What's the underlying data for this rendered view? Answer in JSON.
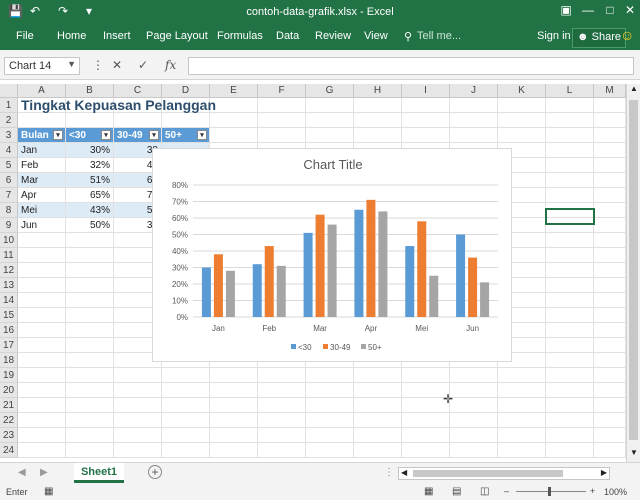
{
  "window": {
    "title": "contoh-data-grafik.xlsx - Excel"
  },
  "ribbon": {
    "tabs": [
      "File",
      "Home",
      "Insert",
      "Page Layout",
      "Formulas",
      "Data",
      "Review",
      "View"
    ],
    "tellme": "Tell me...",
    "signin": "Sign in",
    "share": "Share"
  },
  "formula": {
    "namebox": "Chart 14",
    "value": ""
  },
  "columns": [
    "A",
    "B",
    "C",
    "D",
    "E",
    "F",
    "G",
    "H",
    "I",
    "J",
    "K",
    "L",
    "M"
  ],
  "rows": [
    "1",
    "2",
    "3",
    "4",
    "5",
    "6",
    "7",
    "8",
    "9",
    "10",
    "11",
    "12",
    "13",
    "14",
    "15",
    "16",
    "17",
    "18",
    "19",
    "20",
    "21",
    "22",
    "23",
    "24"
  ],
  "sheet": {
    "title": "Tingkat Kepuasan Pelanggan",
    "headers": [
      "Bulan",
      "<30",
      "30-49",
      "50+"
    ],
    "data": [
      [
        "Jan",
        "30%",
        "38"
      ],
      [
        "Feb",
        "32%",
        "43"
      ],
      [
        "Mar",
        "51%",
        "62"
      ],
      [
        "Apr",
        "65%",
        "71"
      ],
      [
        "Mei",
        "43%",
        "58"
      ],
      [
        "Jun",
        "50%",
        "36"
      ]
    ]
  },
  "chart_data": {
    "type": "bar",
    "title": "Chart Title",
    "categories": [
      "Jan",
      "Feb",
      "Mar",
      "Apr",
      "Mei",
      "Jun"
    ],
    "series": [
      {
        "name": "<30",
        "values": [
          30,
          32,
          51,
          65,
          43,
          50
        ],
        "color": "#5b9bd5"
      },
      {
        "name": "30-49",
        "values": [
          38,
          43,
          62,
          71,
          58,
          36
        ],
        "color": "#ed7d31"
      },
      {
        "name": "50+",
        "values": [
          28,
          31,
          56,
          64,
          25,
          21
        ],
        "color": "#a5a5a5"
      }
    ],
    "yticks": [
      "0%",
      "10%",
      "20%",
      "30%",
      "40%",
      "50%",
      "60%",
      "70%",
      "80%"
    ],
    "ylim": [
      0,
      80
    ],
    "legend": "bottom",
    "grid": true
  },
  "tabs": {
    "sheet": "Sheet1"
  },
  "status": {
    "mode": "Enter",
    "zoom": "100%"
  }
}
